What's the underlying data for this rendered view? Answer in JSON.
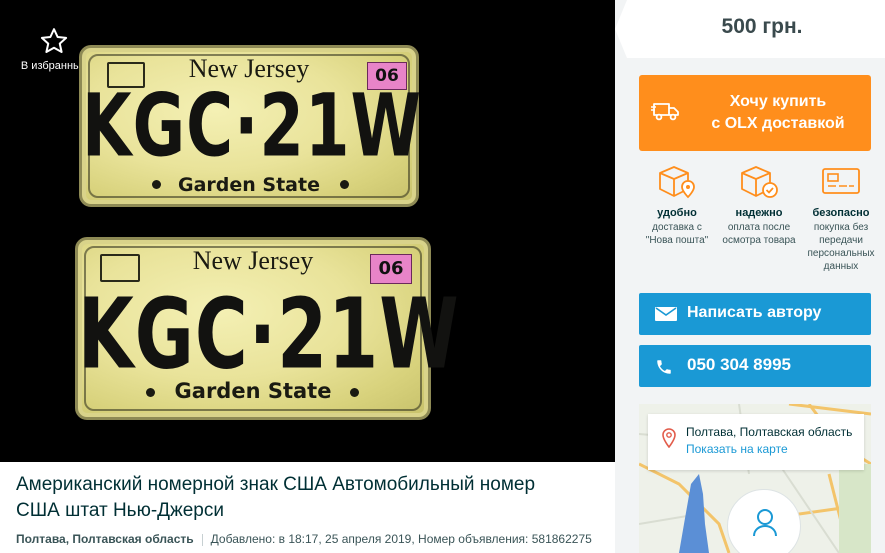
{
  "favorite": {
    "label": "В избранные",
    "icon": "star-outline-icon"
  },
  "photo": {
    "plates": [
      {
        "state": "New Jersey",
        "number": "KGC·21W",
        "motto": "Garden State",
        "sticker": "06"
      },
      {
        "state": "New Jersey",
        "number": "KGC·21W",
        "motto": "Garden State",
        "sticker": "06"
      }
    ]
  },
  "ad": {
    "title": "Американский номерной знак США Автомобильный номер США штат Нью-Джерси",
    "location": "Полтава, Полтавская область",
    "added": "Добавлено: в 18:17, 25 апреля 2019",
    "ad_number": "Номер объявления: 581862275"
  },
  "price": "500 грн.",
  "buy_button": {
    "line1": "Хочу купить",
    "line2": "с OLX доставкой",
    "icon": "truck-icon"
  },
  "features": [
    {
      "title": "удобно",
      "desc": "доставка с \"Нова пошта\"",
      "icon": "box-location-icon"
    },
    {
      "title": "надежно",
      "desc": "оплата после осмотра товара",
      "icon": "box-check-icon"
    },
    {
      "title": "безопасно",
      "desc": "покупка без передачи персональных данных",
      "icon": "card-icon"
    }
  ],
  "message_button": {
    "label": "Написать автору",
    "icon": "envelope-icon"
  },
  "phone_button": {
    "label": "050 304 8995",
    "icon": "phone-icon"
  },
  "map": {
    "city": "Полтава, Полтавская область",
    "show_map": "Показать на карте",
    "icon": "map-pin-icon"
  },
  "colors": {
    "accent_orange": "#ff8e1c",
    "accent_blue": "#1a99d5",
    "text_dark": "#002f34"
  }
}
